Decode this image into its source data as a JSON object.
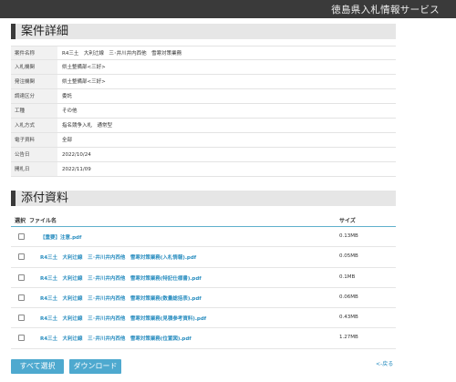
{
  "header": {
    "site_title": "徳島県入札情報サービス"
  },
  "details_section": {
    "heading": "案件詳細",
    "rows": [
      {
        "label": "案件名称",
        "value": "R4三土　大利辻線　三･井川井内西他　雪寒対策業務"
      },
      {
        "label": "入札機関",
        "value": "県土整備部<三好>"
      },
      {
        "label": "発注機関",
        "value": "県土整備部<三好>"
      },
      {
        "label": "調達区分",
        "value": "委託"
      },
      {
        "label": "工種",
        "value": "その他"
      },
      {
        "label": "入札方式",
        "value": "指名競争入札　通常型"
      },
      {
        "label": "電子資料",
        "value": "全部"
      },
      {
        "label": "公告日",
        "value": "2022/10/24"
      },
      {
        "label": "開札日",
        "value": "2022/11/09"
      }
    ]
  },
  "attachments_section": {
    "heading": "添付資料",
    "columns": {
      "select": "選択",
      "filename": "ファイル名",
      "size": "サイズ"
    },
    "files": [
      {
        "name": "【重要】注意.pdf",
        "size": "0.13MB"
      },
      {
        "name": "R4三土　大利辻線　三･井川井内西他　雪寒対策業務(入札情報).pdf",
        "size": "0.05MB"
      },
      {
        "name": "R4三土　大利辻線　三･井川井内西他　雪寒対策業務(特記仕様書).pdf",
        "size": "0.1MB"
      },
      {
        "name": "R4三土　大利辻線　三･井川井内西他　雪寒対策業務(数量総括表).pdf",
        "size": "0.06MB"
      },
      {
        "name": "R4三土　大利辻線　三･井川井内西他　雪寒対策業務(見積参考資料).pdf",
        "size": "0.43MB"
      },
      {
        "name": "R4三土　大利辻線　三･井川井内西他　雪寒対策業務(位置図).pdf",
        "size": "1.27MB"
      }
    ]
  },
  "actions": {
    "select_all_label": "すべて選択",
    "download_label": "ダウンロード",
    "back_label": "<-戻る"
  }
}
